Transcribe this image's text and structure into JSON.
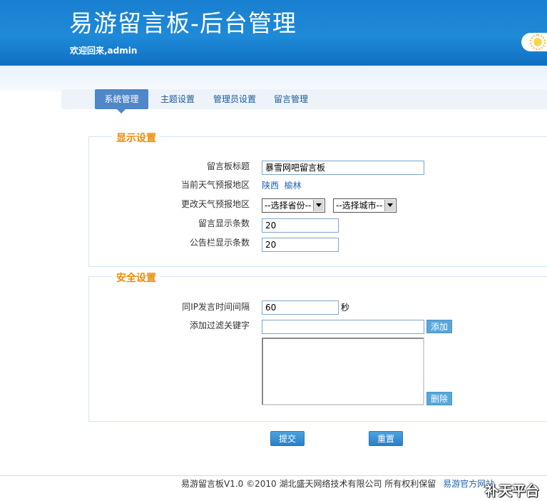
{
  "header": {
    "title": "易游留言板-后台管理",
    "welcome": "欢迎回来,admin"
  },
  "nav": {
    "tabs": [
      {
        "label": "系统管理",
        "active": true
      },
      {
        "label": "主题设置",
        "active": false
      },
      {
        "label": "管理员设置",
        "active": false
      },
      {
        "label": "留言管理",
        "active": false
      }
    ]
  },
  "display_settings": {
    "title": "显示设置",
    "board_title_label": "留言板标题",
    "board_title_value": "暴雪网吧留言板",
    "current_region_label": "当前天气预报地区",
    "current_region_province": "陕西",
    "current_region_city": "榆林",
    "change_region_label": "更改天气预报地区",
    "province_select": "--选择省份--",
    "city_select": "--选择城市--",
    "message_count_label": "留言显示条数",
    "message_count_value": "20",
    "notice_count_label": "公告栏显示条数",
    "notice_count_value": "20"
  },
  "security_settings": {
    "title": "安全设置",
    "ip_interval_label": "同IP发言时间间隔",
    "ip_interval_value": "60",
    "ip_interval_unit": "秒",
    "filter_label": "添加过滤关键字",
    "filter_value": "",
    "add_button": "添加",
    "delete_button": "删除"
  },
  "actions": {
    "submit": "提交",
    "reset": "重置"
  },
  "footer": {
    "copyright": "易游留言板V1.0 ©2010 湖北盛天网络技术有限公司  所有权利保留",
    "link": "易游官方网站"
  },
  "watermark": "补天平台",
  "colors": {
    "header_blue": "#1e8ad8",
    "section_title_orange": "#f08a00",
    "nav_active": "#4f87c8"
  }
}
